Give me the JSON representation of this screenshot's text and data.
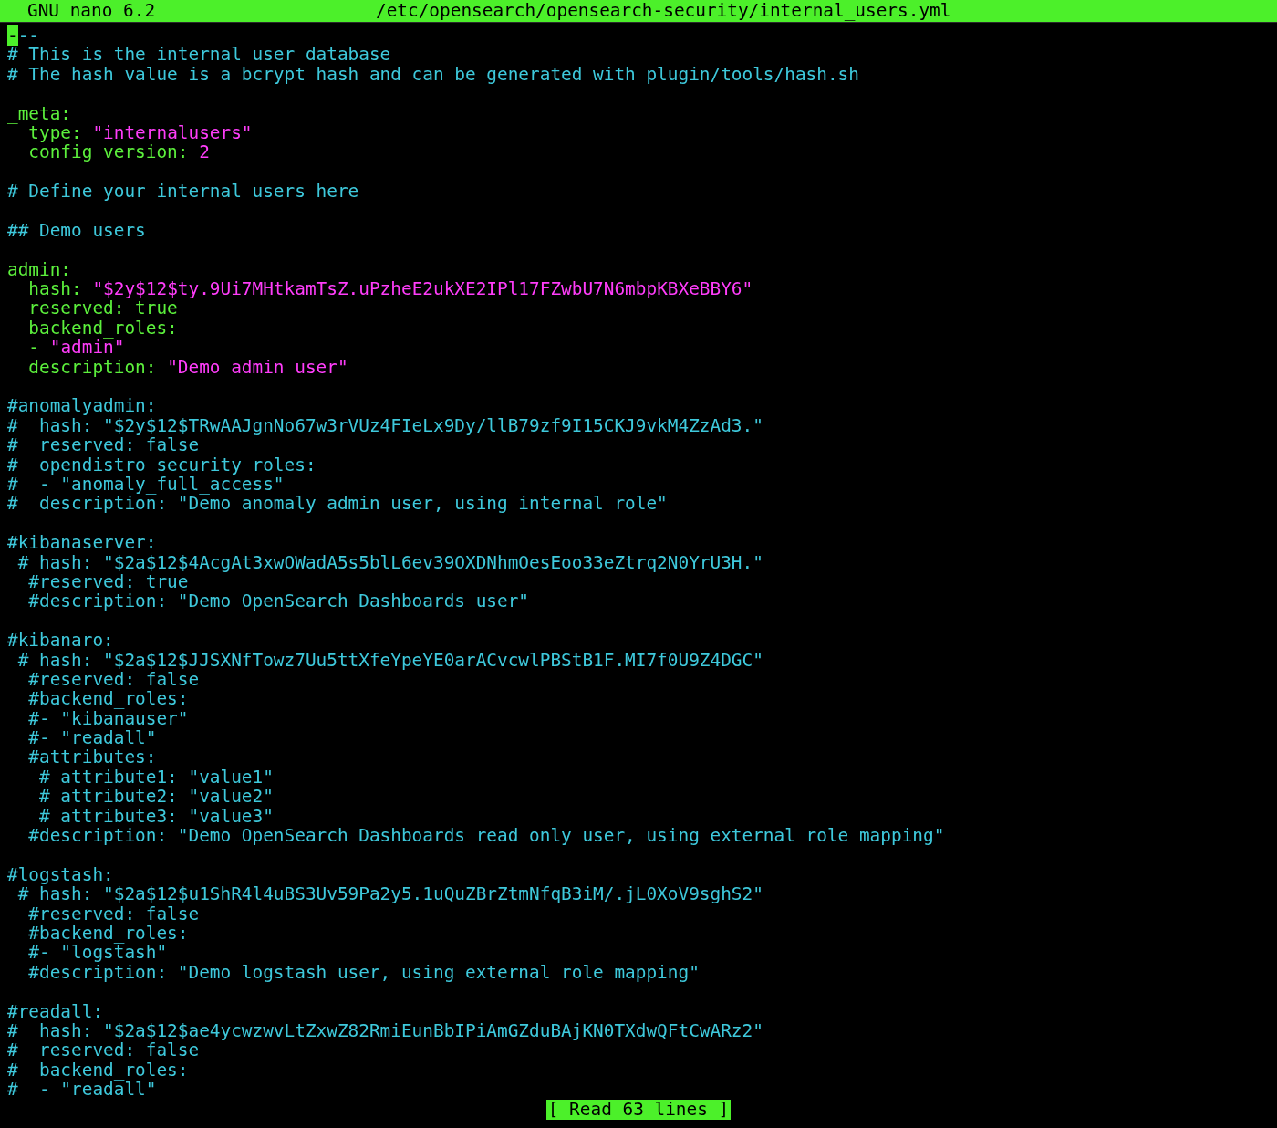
{
  "title_bar": {
    "app": "GNU nano 6.2",
    "file": "/etc/opensearch/opensearch-security/internal_users.yml"
  },
  "lines": [
    {
      "kind": "text",
      "segments": [
        {
          "kind": "cursor",
          "text": "-"
        },
        {
          "kind": "comment",
          "text": "--"
        }
      ]
    },
    {
      "kind": "text",
      "segments": [
        {
          "kind": "comment",
          "text": "# This is the internal user database"
        }
      ]
    },
    {
      "kind": "text",
      "segments": [
        {
          "kind": "comment",
          "text": "# The hash value is a bcrypt hash and can be generated with plugin/tools/hash.sh"
        }
      ]
    },
    {
      "kind": "blank"
    },
    {
      "kind": "text",
      "segments": [
        {
          "kind": "key",
          "text": "_meta:"
        }
      ]
    },
    {
      "kind": "text",
      "segments": [
        {
          "kind": "key",
          "text": "  type: "
        },
        {
          "kind": "string",
          "text": "\"internalusers\""
        }
      ]
    },
    {
      "kind": "text",
      "segments": [
        {
          "kind": "key",
          "text": "  config_version: "
        },
        {
          "kind": "string",
          "text": "2"
        }
      ]
    },
    {
      "kind": "blank"
    },
    {
      "kind": "text",
      "segments": [
        {
          "kind": "comment",
          "text": "# Define your internal users here"
        }
      ]
    },
    {
      "kind": "blank"
    },
    {
      "kind": "text",
      "segments": [
        {
          "kind": "comment",
          "text": "## Demo users"
        }
      ]
    },
    {
      "kind": "blank"
    },
    {
      "kind": "text",
      "segments": [
        {
          "kind": "key",
          "text": "admin:"
        }
      ]
    },
    {
      "kind": "text",
      "segments": [
        {
          "kind": "key",
          "text": "  hash: "
        },
        {
          "kind": "string",
          "text": "\"$2y$12$ty.9Ui7MHtkamTsZ.uPzheE2ukXE2IPl17FZwbU7N6mbpKBXeBBY6\""
        }
      ]
    },
    {
      "kind": "text",
      "segments": [
        {
          "kind": "key",
          "text": "  reserved: true"
        }
      ]
    },
    {
      "kind": "text",
      "segments": [
        {
          "kind": "key",
          "text": "  backend_roles:"
        }
      ]
    },
    {
      "kind": "text",
      "segments": [
        {
          "kind": "key",
          "text": "  - "
        },
        {
          "kind": "string",
          "text": "\"admin\""
        }
      ]
    },
    {
      "kind": "text",
      "segments": [
        {
          "kind": "key",
          "text": "  description: "
        },
        {
          "kind": "string",
          "text": "\"Demo admin user\""
        }
      ]
    },
    {
      "kind": "blank"
    },
    {
      "kind": "text",
      "segments": [
        {
          "kind": "comment",
          "text": "#anomalyadmin:"
        }
      ]
    },
    {
      "kind": "text",
      "segments": [
        {
          "kind": "comment",
          "text": "#  hash: \"$2y$12$TRwAAJgnNo67w3rVUz4FIeLx9Dy/llB79zf9I15CKJ9vkM4ZzAd3.\""
        }
      ]
    },
    {
      "kind": "text",
      "segments": [
        {
          "kind": "comment",
          "text": "#  reserved: false"
        }
      ]
    },
    {
      "kind": "text",
      "segments": [
        {
          "kind": "comment",
          "text": "#  opendistro_security_roles:"
        }
      ]
    },
    {
      "kind": "text",
      "segments": [
        {
          "kind": "comment",
          "text": "#  - \"anomaly_full_access\""
        }
      ]
    },
    {
      "kind": "text",
      "segments": [
        {
          "kind": "comment",
          "text": "#  description: \"Demo anomaly admin user, using internal role\""
        }
      ]
    },
    {
      "kind": "blank"
    },
    {
      "kind": "text",
      "segments": [
        {
          "kind": "comment",
          "text": "#kibanaserver:"
        }
      ]
    },
    {
      "kind": "text",
      "segments": [
        {
          "kind": "comment",
          "text": " # hash: \"$2a$12$4AcgAt3xwOWadA5s5blL6ev39OXDNhmOesEoo33eZtrq2N0YrU3H.\""
        }
      ]
    },
    {
      "kind": "text",
      "segments": [
        {
          "kind": "comment",
          "text": "  #reserved: true"
        }
      ]
    },
    {
      "kind": "text",
      "segments": [
        {
          "kind": "comment",
          "text": "  #description: \"Demo OpenSearch Dashboards user\""
        }
      ]
    },
    {
      "kind": "blank"
    },
    {
      "kind": "text",
      "segments": [
        {
          "kind": "comment",
          "text": "#kibanaro:"
        }
      ]
    },
    {
      "kind": "text",
      "segments": [
        {
          "kind": "comment",
          "text": " # hash: \"$2a$12$JJSXNfTowz7Uu5ttXfeYpeYE0arACvcwlPBStB1F.MI7f0U9Z4DGC\""
        }
      ]
    },
    {
      "kind": "text",
      "segments": [
        {
          "kind": "comment",
          "text": "  #reserved: false"
        }
      ]
    },
    {
      "kind": "text",
      "segments": [
        {
          "kind": "comment",
          "text": "  #backend_roles:"
        }
      ]
    },
    {
      "kind": "text",
      "segments": [
        {
          "kind": "comment",
          "text": "  #- \"kibanauser\""
        }
      ]
    },
    {
      "kind": "text",
      "segments": [
        {
          "kind": "comment",
          "text": "  #- \"readall\""
        }
      ]
    },
    {
      "kind": "text",
      "segments": [
        {
          "kind": "comment",
          "text": "  #attributes:"
        }
      ]
    },
    {
      "kind": "text",
      "segments": [
        {
          "kind": "comment",
          "text": "   # attribute1: \"value1\""
        }
      ]
    },
    {
      "kind": "text",
      "segments": [
        {
          "kind": "comment",
          "text": "   # attribute2: \"value2\""
        }
      ]
    },
    {
      "kind": "text",
      "segments": [
        {
          "kind": "comment",
          "text": "   # attribute3: \"value3\""
        }
      ]
    },
    {
      "kind": "text",
      "segments": [
        {
          "kind": "comment",
          "text": "  #description: \"Demo OpenSearch Dashboards read only user, using external role mapping\""
        }
      ]
    },
    {
      "kind": "blank"
    },
    {
      "kind": "text",
      "segments": [
        {
          "kind": "comment",
          "text": "#logstash:"
        }
      ]
    },
    {
      "kind": "text",
      "segments": [
        {
          "kind": "comment",
          "text": " # hash: \"$2a$12$u1ShR4l4uBS3Uv59Pa2y5.1uQuZBrZtmNfqB3iM/.jL0XoV9sghS2\""
        }
      ]
    },
    {
      "kind": "text",
      "segments": [
        {
          "kind": "comment",
          "text": "  #reserved: false"
        }
      ]
    },
    {
      "kind": "text",
      "segments": [
        {
          "kind": "comment",
          "text": "  #backend_roles:"
        }
      ]
    },
    {
      "kind": "text",
      "segments": [
        {
          "kind": "comment",
          "text": "  #- \"logstash\""
        }
      ]
    },
    {
      "kind": "text",
      "segments": [
        {
          "kind": "comment",
          "text": "  #description: \"Demo logstash user, using external role mapping\""
        }
      ]
    },
    {
      "kind": "blank"
    },
    {
      "kind": "text",
      "segments": [
        {
          "kind": "comment",
          "text": "#readall:"
        }
      ]
    },
    {
      "kind": "text",
      "segments": [
        {
          "kind": "comment",
          "text": "#  hash: \"$2a$12$ae4ycwzwvLtZxwZ82RmiEunBbIPiAmGZduBAjKN0TXdwQFtCwARz2\""
        }
      ]
    },
    {
      "kind": "text",
      "segments": [
        {
          "kind": "comment",
          "text": "#  reserved: false"
        }
      ]
    },
    {
      "kind": "text",
      "segments": [
        {
          "kind": "comment",
          "text": "#  backend_roles:"
        }
      ]
    },
    {
      "kind": "text",
      "segments": [
        {
          "kind": "comment",
          "text": "#  - \"readall\""
        }
      ]
    }
  ],
  "status_bar": {
    "message": "[ Read 63 lines ]"
  }
}
